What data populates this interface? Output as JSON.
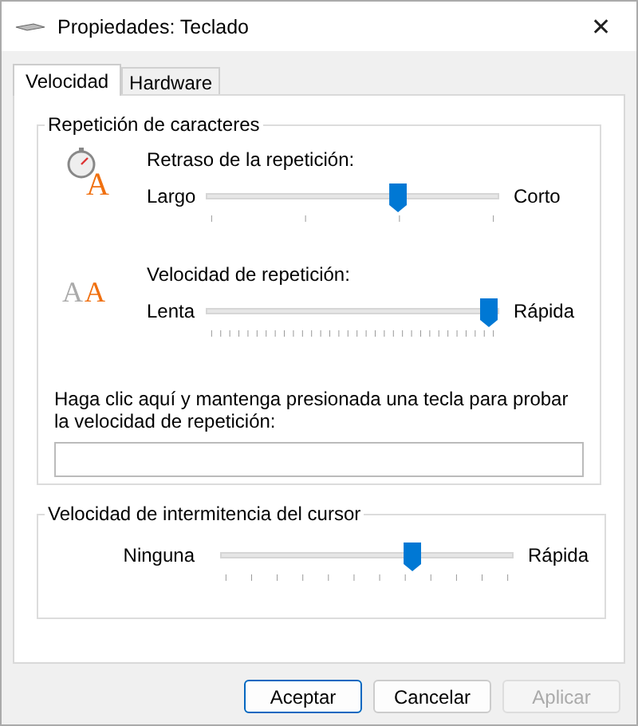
{
  "window": {
    "title": "Propiedades: Teclado",
    "close": "✕"
  },
  "tabs": [
    {
      "label": "Velocidad",
      "selected": true
    },
    {
      "label": "Hardware",
      "selected": false
    }
  ],
  "character_repeat": {
    "title": "Repetición de caracteres",
    "sliders": [
      {
        "kind": "delay",
        "icon_letters": [
          "A"
        ],
        "label": "Retraso de la repetición:",
        "min_label": "Largo",
        "max_label": "Corto",
        "level": 0.667
      },
      {
        "kind": "rate",
        "icon_letters": [
          "A",
          "A"
        ],
        "label": "Velocidad de repetición:",
        "min_label": "Lenta",
        "max_label": "Rápida",
        "level": 1
      }
    ],
    "test_prompt": "Haga clic aquí y mantenga presionada una tecla para probar la velocidad de repetición:"
  },
  "cursor_blink": {
    "title": "Velocidad de intermitencia del cursor",
    "min_label": "Ninguna",
    "max_label": "Rápida",
    "level": 0.667
  },
  "buttons": [
    {
      "label": "Aceptar",
      "default": true,
      "disabled": false
    },
    {
      "label": "Cancelar",
      "default": false,
      "disabled": false
    },
    {
      "label": "Aplicar",
      "default": false,
      "disabled": true
    }
  ]
}
